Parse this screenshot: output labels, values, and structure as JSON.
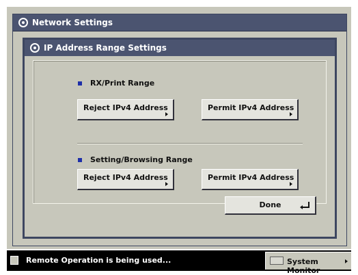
{
  "window": {
    "title": "Network Settings"
  },
  "dialog": {
    "title": "IP Address Range Settings",
    "sections": [
      {
        "label": "RX/Print Range",
        "reject_label": "Reject IPv4 Address",
        "permit_label": "Permit IPv4 Address"
      },
      {
        "label": "Setting/Browsing Range",
        "reject_label": "Reject IPv4 Address",
        "permit_label": "Permit IPv4 Address"
      }
    ],
    "done_label": "Done"
  },
  "status_bar": {
    "message": "Remote Operation is being used...",
    "system_monitor_label": "System Monitor"
  },
  "colors": {
    "title_bar": "#4b5470",
    "panel_bg": "#c7c7bb",
    "bullet": "#1e2fa8"
  }
}
